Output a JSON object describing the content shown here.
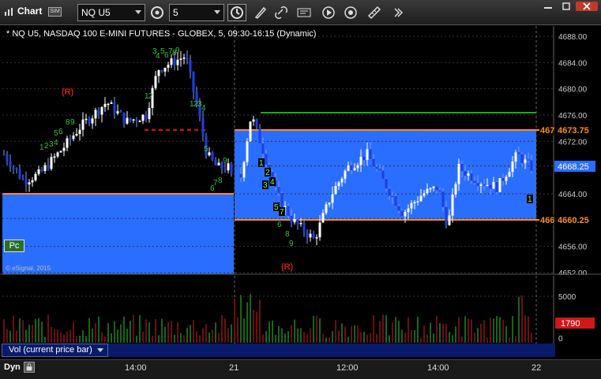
{
  "toolbar": {
    "title": "Chart",
    "sim_badge": "SIM",
    "symbol_value": "NQ U5",
    "interval_value": "5"
  },
  "chart": {
    "title": "* NQ U5, NASDAQ 100 E-MINI FUTURES - GLOBEX, 5, 09:30-16:15 (Dynamic)",
    "watermark": "© eSignal, 2015",
    "pc_button": "Pc",
    "price_ticks": [
      "4688.00",
      "4684.00",
      "4680.00",
      "4676.00",
      "4672.00",
      "4668.25",
      "4664.00",
      "4660.25",
      "4656.00",
      "4652.00"
    ],
    "price_tags": {
      "upper": "4673.75",
      "upper_cut": "467",
      "lower": "4660.25",
      "lower_cut": "466",
      "current": "4668.25"
    },
    "annotations": {
      "r_top": "(R)",
      "r_bottom": "(R)"
    },
    "colors": {
      "up_candle": "#ffffff",
      "down_candle": "#1f3fe0",
      "band": "#2a6eff",
      "orange": "#ff8c1a",
      "green_line": "#1faa1f",
      "red_dash": "#e01010"
    }
  },
  "volume": {
    "label": "Vol (current price bar)",
    "ticks": [
      "5000",
      "0"
    ],
    "current": "1790"
  },
  "bottom": {
    "dyn": "Dyn",
    "times": [
      "14:00",
      "21",
      "12:00",
      "14:00",
      "22"
    ]
  }
}
